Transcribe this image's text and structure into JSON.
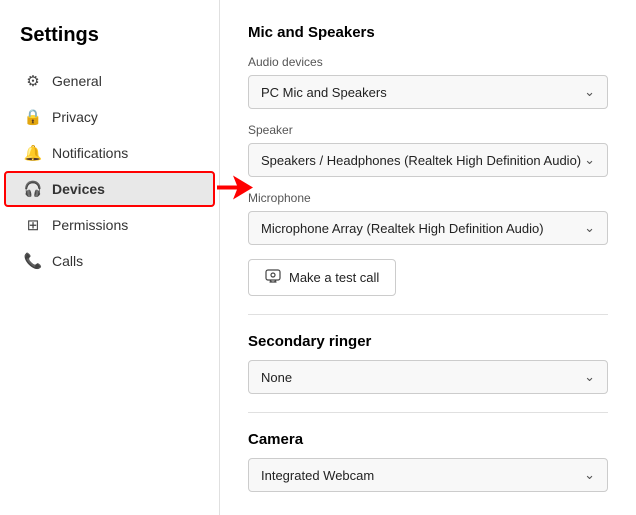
{
  "sidebar": {
    "title": "Settings",
    "items": [
      {
        "id": "general",
        "label": "General",
        "icon": "⚙"
      },
      {
        "id": "privacy",
        "label": "Privacy",
        "icon": "🔒"
      },
      {
        "id": "notifications",
        "label": "Notifications",
        "icon": "🔔"
      },
      {
        "id": "devices",
        "label": "Devices",
        "icon": "🎧",
        "active": true
      },
      {
        "id": "permissions",
        "label": "Permissions",
        "icon": "⊞"
      },
      {
        "id": "calls",
        "label": "Calls",
        "icon": "📞"
      }
    ]
  },
  "main": {
    "section_mic_speakers": "Mic and Speakers",
    "audio_devices_label": "Audio devices",
    "audio_devices_value": "PC Mic and Speakers",
    "speaker_label": "Speaker",
    "speaker_value": "Speakers / Headphones (Realtek High Definition Audio)",
    "microphone_label": "Microphone",
    "microphone_value": "Microphone Array (Realtek High Definition Audio)",
    "test_call_label": "Make a test call",
    "secondary_ringer_label": "Secondary ringer",
    "secondary_ringer_section": "Secondary ringer",
    "secondary_ringer_value": "None",
    "camera_label": "Camera",
    "camera_section": "Camera",
    "camera_value": "Integrated Webcam"
  }
}
